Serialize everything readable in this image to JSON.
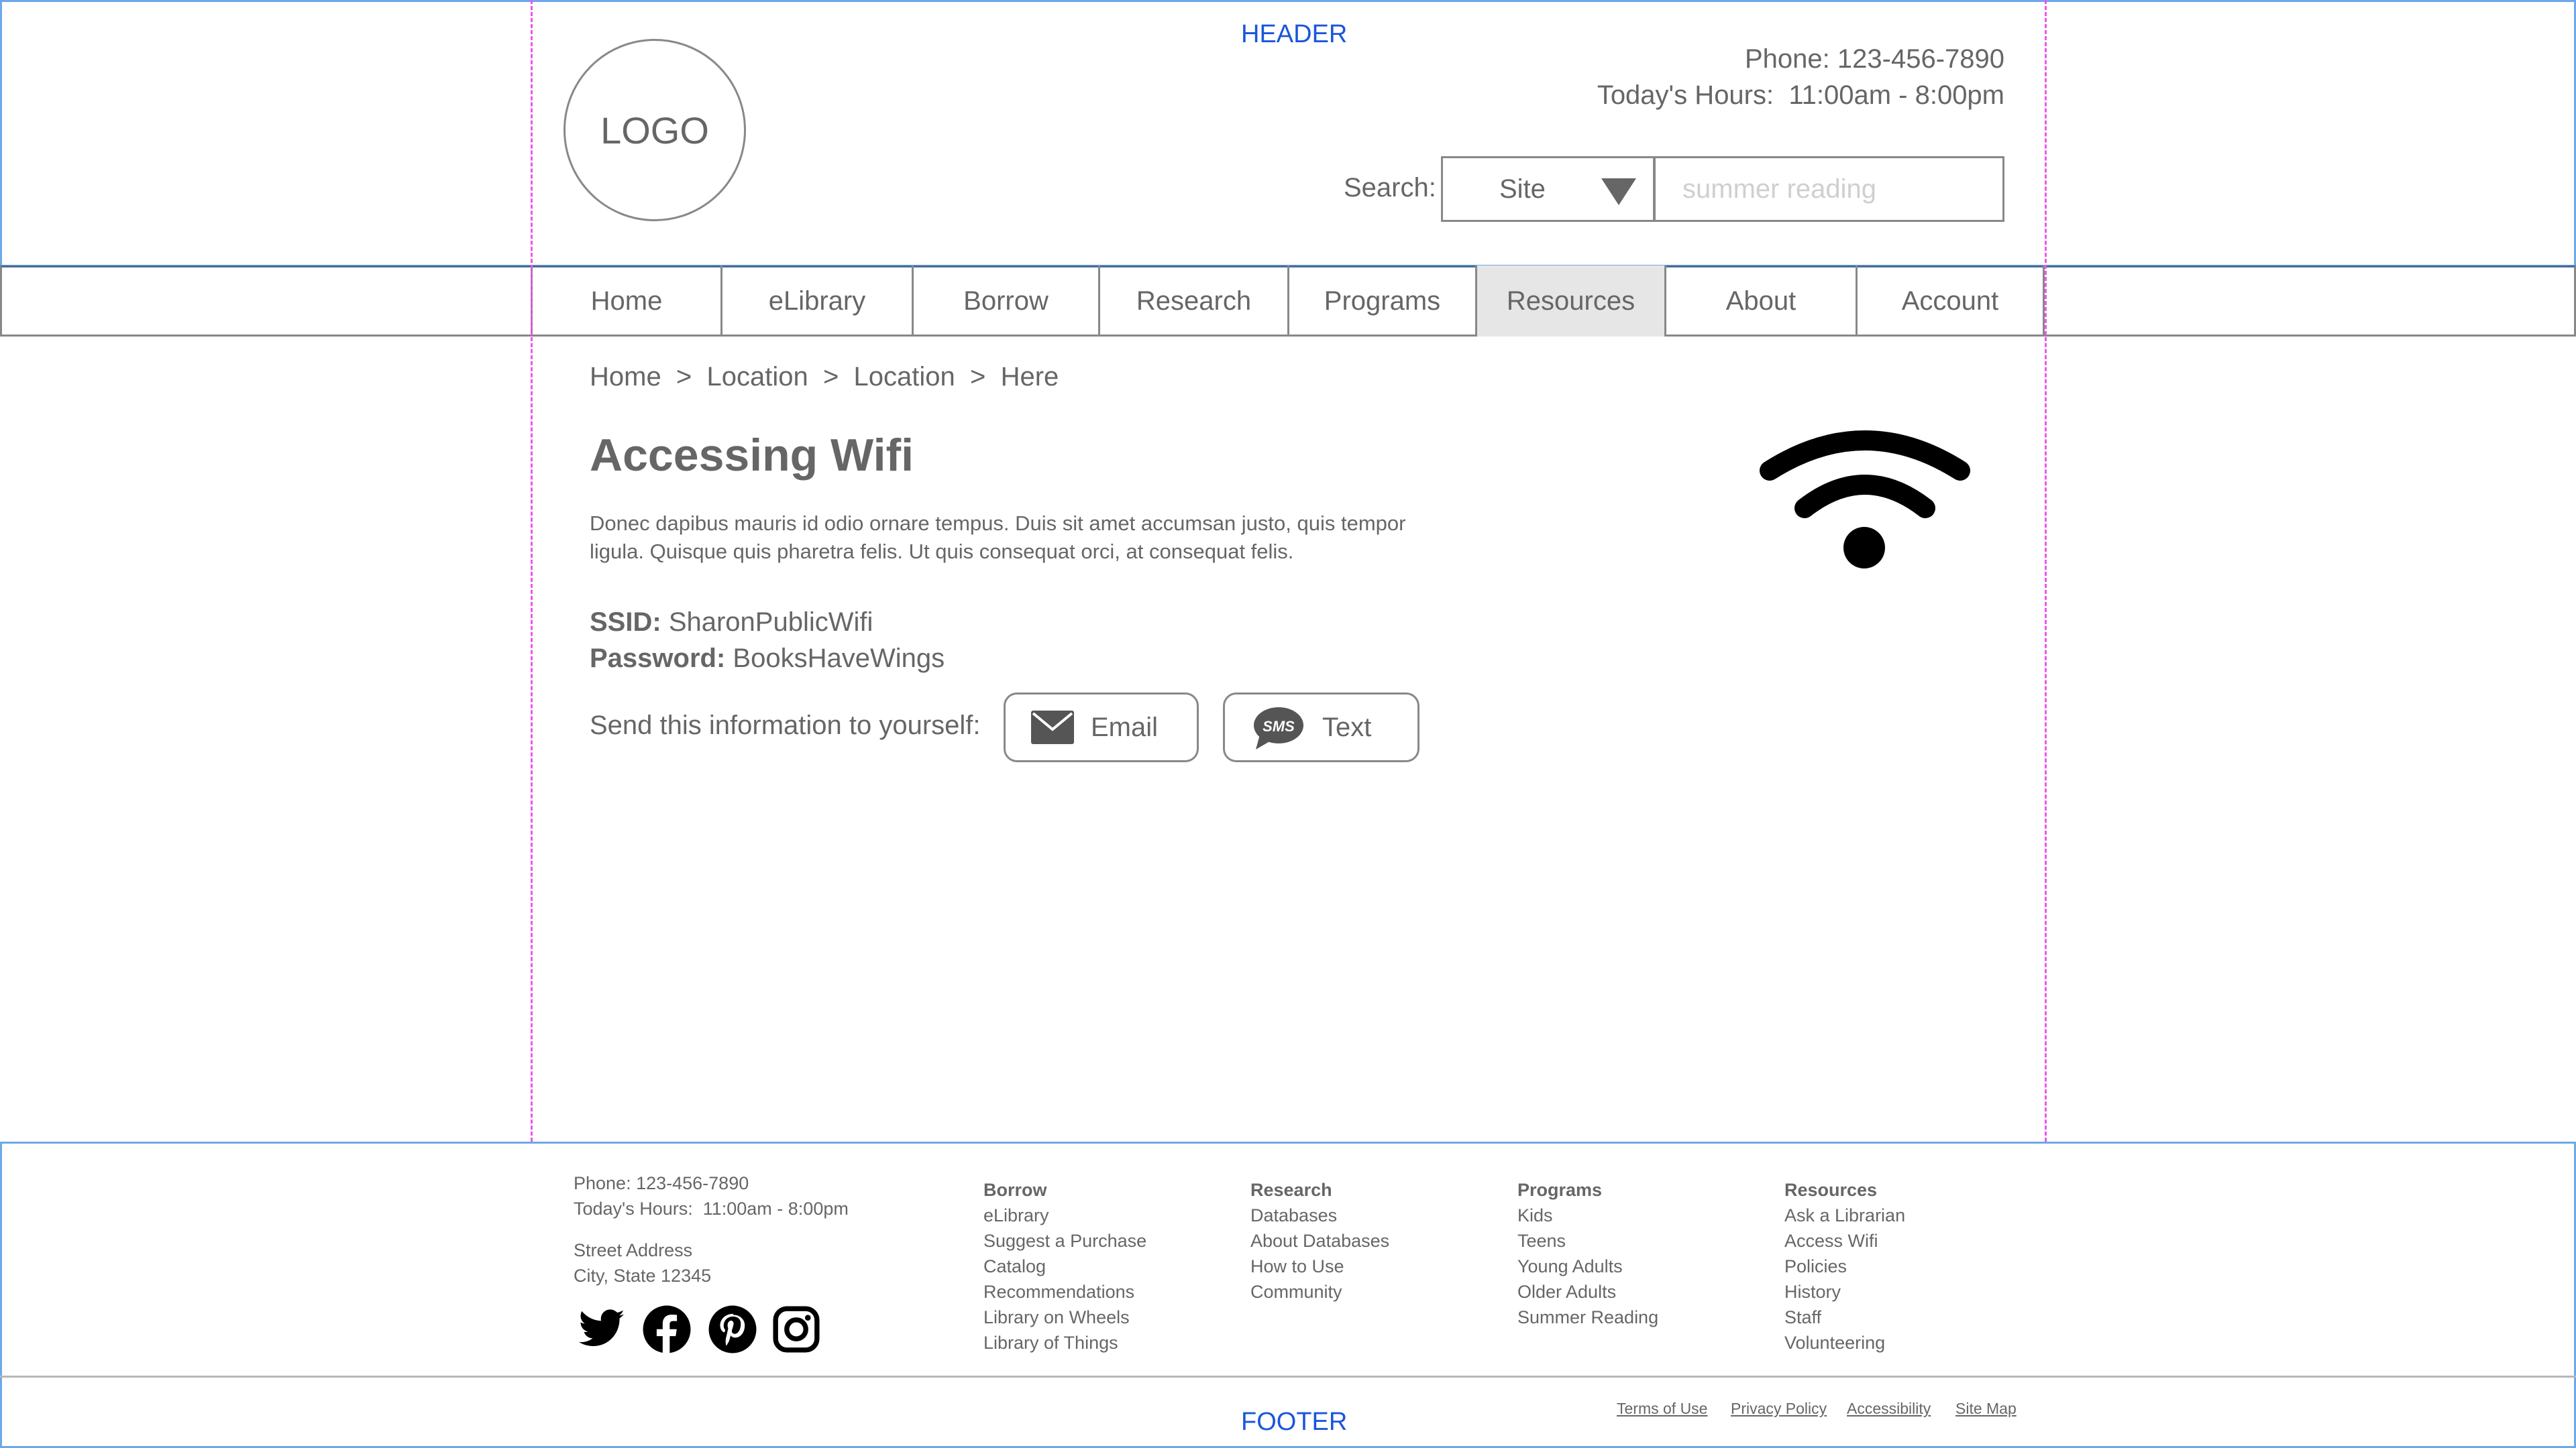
{
  "header": {
    "label": "HEADER",
    "logo": "LOGO",
    "phone": "Phone: 123-456-7890",
    "hours": "Today's Hours:  11:00am - 8:00pm",
    "search": {
      "label": "Search:",
      "scope": "Site",
      "placeholder": "summer reading"
    }
  },
  "nav": {
    "items": [
      "Home",
      "eLibrary",
      "Borrow",
      "Research",
      "Programs",
      "Resources",
      "About",
      "Account"
    ],
    "active": "Resources"
  },
  "main": {
    "breadcrumb": "Home  >  Location  >  Location  >  Here",
    "title": "Accessing Wifi",
    "body": "Donec dapibus mauris id odio ornare tempus. Duis sit amet accumsan justo, quis tempor ligula. Quisque quis pharetra felis. Ut quis consequat orci, at consequat felis.",
    "ssid_label": "SSID:",
    "ssid_value": "SharonPublicWifi",
    "password_label": "Password:",
    "password_value": "BooksHaveWings",
    "send_label": "Send this information to yourself:",
    "email_label": "Email",
    "text_label": "Text",
    "sms_badge": "SMS",
    "icons": [
      "wifi-icon",
      "envelope-icon",
      "sms-bubble-icon"
    ]
  },
  "footer": {
    "label": "FOOTER",
    "phone": "Phone: 123-456-7890",
    "hours": "Today's Hours:  11:00am - 8:00pm",
    "street": "Street Address",
    "city": "City, State 12345",
    "social": [
      "twitter-icon",
      "facebook-icon",
      "pinterest-icon",
      "instagram-icon"
    ],
    "columns": {
      "borrow": {
        "head": "Borrow",
        "links": [
          "eLibrary",
          "Suggest a Purchase",
          "Catalog",
          "Recommendations",
          "Library on Wheels",
          "Library of Things"
        ]
      },
      "research": {
        "head": "Research",
        "links": [
          "Databases",
          "About Databases",
          "How to Use",
          "Community"
        ]
      },
      "programs": {
        "head": "Programs",
        "links": [
          "Kids",
          "Teens",
          "Young Adults",
          "Older Adults",
          "Summer Reading"
        ]
      },
      "resources": {
        "head": "Resources",
        "links": [
          "Ask a Librarian",
          "Access Wifi",
          "Policies",
          "History",
          "Staff",
          "Volunteering"
        ]
      }
    },
    "legal": [
      "Terms of Use",
      "Privacy Policy",
      "Accessibility",
      "Site Map"
    ]
  },
  "colors": {
    "guide": "#ee55ee",
    "section_border": "#6fa8e8",
    "label_blue": "#1a56db",
    "text_gray": "#666666",
    "active_tab": "#e6e6e6"
  }
}
